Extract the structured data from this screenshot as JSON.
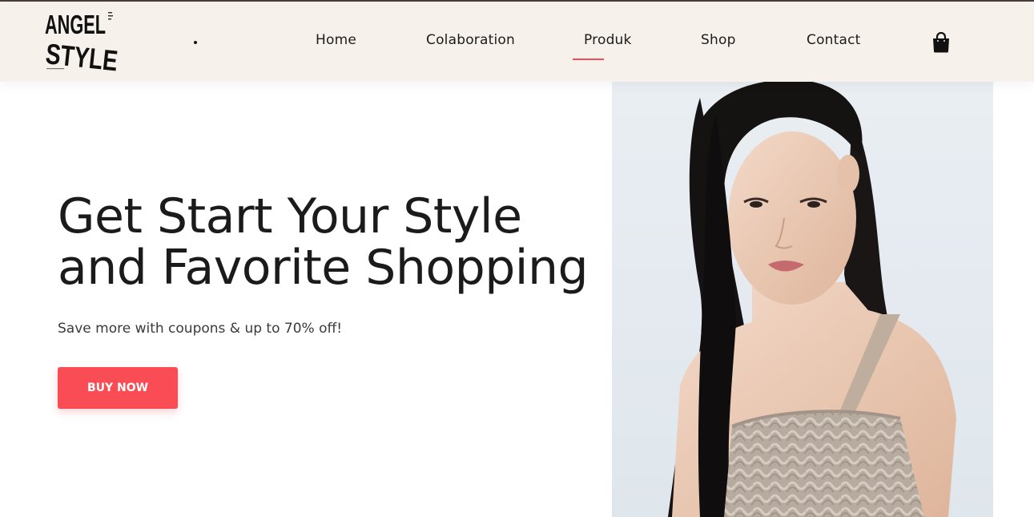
{
  "logo": {
    "line1": "ANGEL",
    "line2": "STYLE"
  },
  "nav": {
    "items": [
      {
        "label": "Home"
      },
      {
        "label": "Colaboration"
      },
      {
        "label": "Produk",
        "active": true
      },
      {
        "label": "Shop"
      },
      {
        "label": "Contact"
      }
    ],
    "accent_color": "#f04f55"
  },
  "icons": {
    "cart": "shopping-bag-icon",
    "bullet": "dot-icon"
  },
  "hero": {
    "title_line1": "Get Start Your Style",
    "title_line2": "and Favorite Shopping",
    "subtitle": "Save more with coupons & up to 70% off!",
    "button_label": "BUY NOW",
    "button_color": "#f94c55",
    "image": "model-photo"
  },
  "colors": {
    "header_bg": "#f6f1eb",
    "text": "#1b1b1b"
  }
}
